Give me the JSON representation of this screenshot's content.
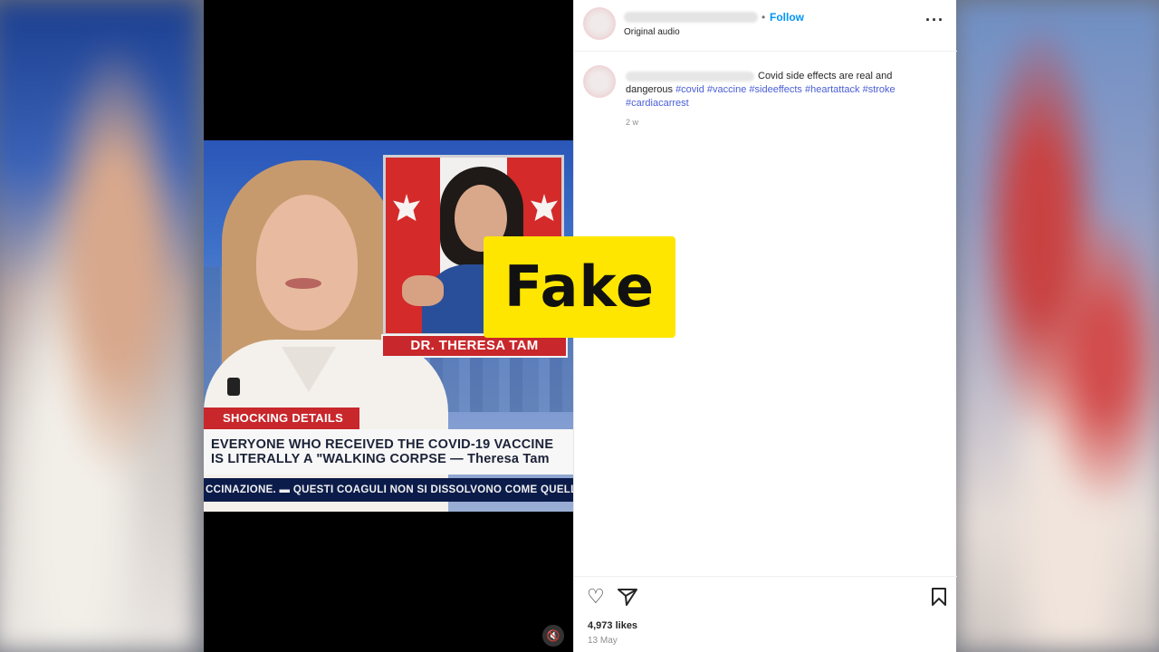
{
  "video": {
    "inset_name": "DR. THERESA TAM",
    "tag": "SHOCKING DETAILS",
    "headline_line1": "EVERYONE WHO RECEIVED THE COVID-19 VACCINE",
    "headline_line2": "IS LITERALLY A \"WALKING CORPSE —  Theresa Tam",
    "ticker": "CCINAZIONE. ▬ QUESTI COAGULI NON SI DISSOLVONO COME QUELLI",
    "mute_icon": "🔇"
  },
  "post": {
    "follow_label": "Follow",
    "dot": "•",
    "audio": "Original audio",
    "more_icon": "···",
    "caption_text": "Covid side effects are real and dangerous",
    "hashtags": [
      "#covid",
      "#vaccine",
      "#sideeffects",
      "#heartattack",
      "#stroke",
      "#cardiacarrest"
    ],
    "age": "2 w",
    "likes": "4,973 likes",
    "date": "13 May",
    "icons": {
      "like": "♡",
      "share": "▽",
      "save": "⚑"
    }
  },
  "stamp": {
    "label": "Fake"
  },
  "colors": {
    "stamp": "#ffe600",
    "follow": "#0095f6",
    "hashtag": "#4a5ed6",
    "news_red": "#c8272b",
    "ticker_bg": "#0c1c4a"
  }
}
